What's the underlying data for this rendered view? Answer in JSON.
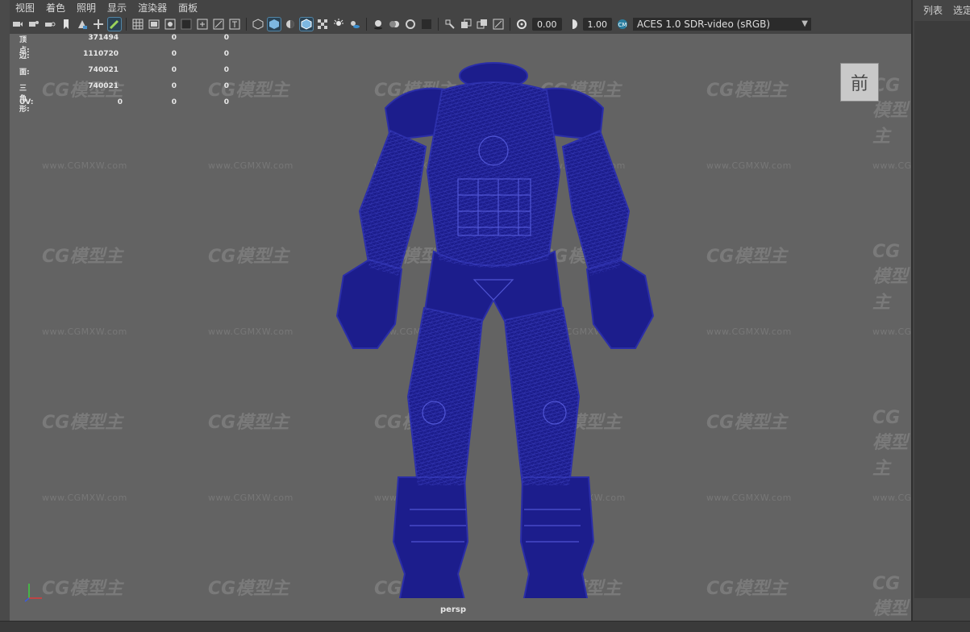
{
  "menu": [
    "视图",
    "着色",
    "照明",
    "显示",
    "渲染器",
    "面板"
  ],
  "toolbar": {
    "icons_group1": [
      "select-camera-icon",
      "camera-attributes-icon",
      "bookmark-icon",
      "image-plane-icon",
      "2d-pan-zoom-icon",
      "grease-pencil-icon"
    ],
    "icons_group2": [
      "grid-icon",
      "film-gate-icon",
      "resolution-gate-icon",
      "gate-mask-icon",
      "field-chart-icon",
      "safe-action-icon",
      "safe-title-icon"
    ],
    "icons_group3": [
      "wireframe-icon",
      "smooth-shade-icon",
      "default-material-icon",
      "wireframe-on-shaded-icon",
      "textured-icon",
      "use-all-lights-icon",
      "shadows-icon"
    ],
    "icons_group4": [
      "screen-space-ao-icon",
      "motion-blur-icon",
      "anti-aliasing-icon",
      "depth-of-field-icon"
    ],
    "icons_group5": [
      "isolate-select-icon",
      "xray-icon",
      "xray-active-icon",
      "xray-joints-icon"
    ],
    "exposure": "0.00",
    "gamma": "1.00",
    "color_space": "ACES 1.0 SDR-video (sRGB)"
  },
  "hud": {
    "rows": [
      {
        "label": "顶点:",
        "v1": "371494",
        "v2": "0",
        "v3": "0"
      },
      {
        "label": "边:",
        "v1": "1110720",
        "v2": "0",
        "v3": "0"
      },
      {
        "label": "面:",
        "v1": "740021",
        "v2": "0",
        "v3": "0"
      },
      {
        "label": "三角形:",
        "v1": "740021",
        "v2": "0",
        "v3": "0"
      },
      {
        "label": "UV:",
        "v1": "0",
        "v2": "0",
        "v3": "0"
      }
    ]
  },
  "view_cube_label": "前",
  "camera_label": "persp",
  "watermark": {
    "logo": "CG模型主",
    "url": "www.CGMXW.com"
  },
  "right_panel": {
    "tab1": "列表",
    "tab2": "选定"
  },
  "colors": {
    "viewport_bg": "#636363",
    "wireframe": "#1c1d8c",
    "ui_bg": "#444444"
  }
}
